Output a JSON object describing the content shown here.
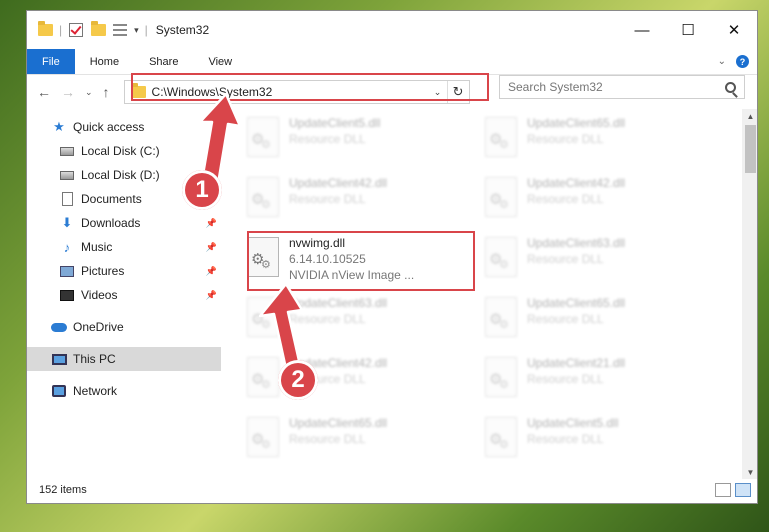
{
  "window": {
    "title": "System32"
  },
  "ribbon": {
    "tabs": [
      "File",
      "Home",
      "Share",
      "View"
    ],
    "help": "?"
  },
  "titlebar": {
    "minimize": "—",
    "maximize": "☐",
    "close": "✕"
  },
  "nav": {
    "back": "←",
    "forward": "→",
    "recent": "⌄",
    "up": "↑"
  },
  "address": {
    "path": "C:\\Windows\\System32",
    "refresh": "↻"
  },
  "search": {
    "placeholder": "Search System32"
  },
  "sidebar": {
    "quick_access": "Quick access",
    "items": [
      {
        "label": "Local Disk (C:)",
        "icon": "disk-icon",
        "pinned": false
      },
      {
        "label": "Local Disk (D:)",
        "icon": "disk-icon",
        "pinned": false
      },
      {
        "label": "Documents",
        "icon": "documents-icon",
        "pinned": false
      },
      {
        "label": "Downloads",
        "icon": "downloads-icon",
        "pinned": true
      },
      {
        "label": "Music",
        "icon": "music-icon",
        "pinned": true
      },
      {
        "label": "Pictures",
        "icon": "pictures-icon",
        "pinned": true
      },
      {
        "label": "Videos",
        "icon": "videos-icon",
        "pinned": true
      }
    ],
    "onedrive": "OneDrive",
    "this_pc": "This PC",
    "network": "Network"
  },
  "files": {
    "left": [
      {
        "name": "UpdateClient5.dll",
        "sub": "Resource DLL"
      },
      {
        "name": "UpdateClient42.dll",
        "sub": "Resource DLL"
      },
      {
        "name": "UpdateClient63.dll",
        "sub": "Resource DLL"
      },
      {
        "name": "UpdateClient42.dll",
        "sub": "Resource DLL"
      },
      {
        "name": "UpdateClient65.dll",
        "sub": "Resource DLL"
      }
    ],
    "right": [
      {
        "name": "UpdateClient65.dll",
        "sub": "Resource DLL"
      },
      {
        "name": "UpdateClient42.dll",
        "sub": "Resource DLL"
      },
      {
        "name": "UpdateClient63.dll",
        "sub": "Resource DLL"
      },
      {
        "name": "UpdateClient65.dll",
        "sub": "Resource DLL"
      },
      {
        "name": "UpdateClient21.dll",
        "sub": "Resource DLL"
      },
      {
        "name": "UpdateClient5.dll",
        "sub": "Resource DLL"
      }
    ],
    "target": {
      "name": "nvwimg.dll",
      "version": "6.14.10.10525",
      "description": "NVIDIA nView Image ..."
    }
  },
  "status": {
    "count": "152 items"
  },
  "callouts": {
    "step1": "1",
    "step2": "2"
  },
  "colors": {
    "accent": "#1a6fd0",
    "highlight": "#d9454a"
  }
}
